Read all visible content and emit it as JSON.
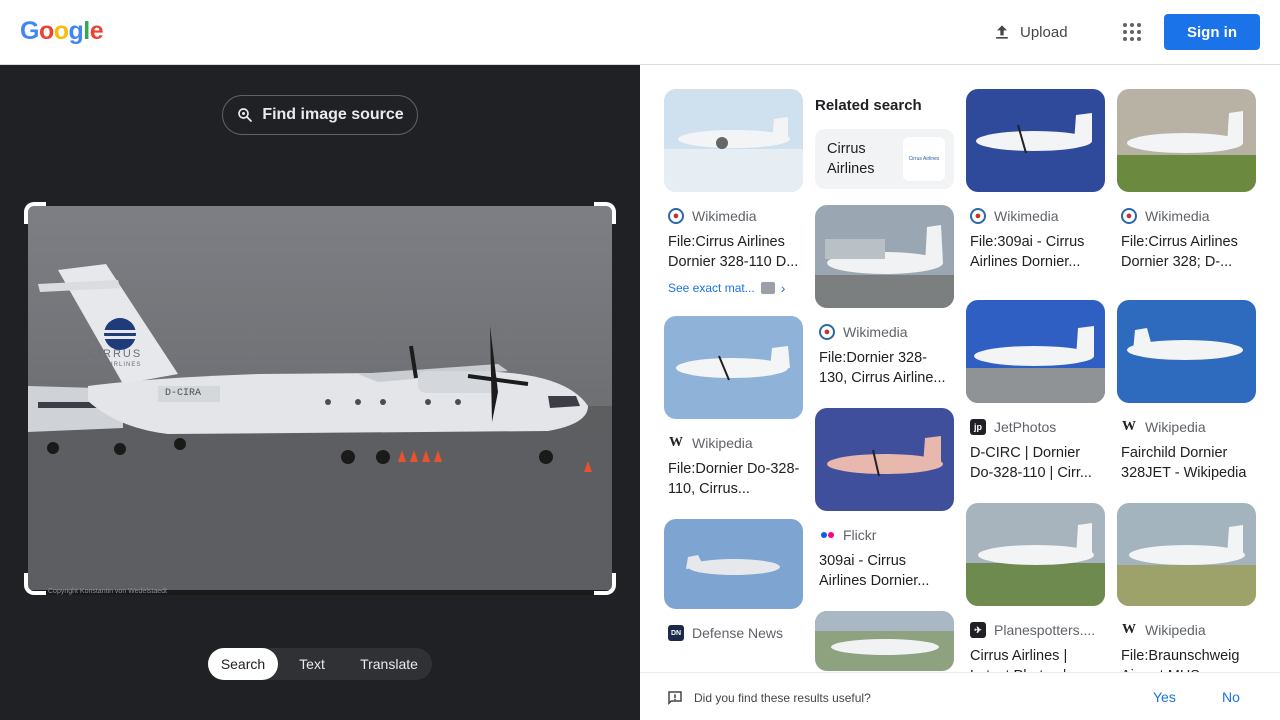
{
  "header": {
    "logo_letters": [
      "G",
      "o",
      "o",
      "g",
      "l",
      "e"
    ],
    "upload_label": "Upload",
    "signin_label": "Sign in"
  },
  "lens": {
    "find_source_label": "Find image source",
    "photo_registration": "D-CIRA",
    "photo_tail_brand": "CIRRUS",
    "photo_tail_sub": "AIRLINES",
    "photo_copyright": "Copyright Konstantin von Wedelstaedt",
    "tabs": [
      "Search",
      "Text",
      "Translate"
    ]
  },
  "results": {
    "col1": [
      {
        "source": "Wikimedia",
        "title": "File:Cirrus Airlines Dornier 328-110 D...",
        "exact": "See exact mat..."
      },
      {
        "source": "Wikipedia",
        "title": "File:Dornier Do-328-110, Cirrus..."
      },
      {
        "source": "Defense News",
        "title": ""
      }
    ],
    "col2": {
      "related_heading": "Related search",
      "related_chip": "Cirrus Airlines",
      "related_mini": "Cirrus Airlines",
      "cards": [
        {
          "source": "Wikimedia",
          "title": "File:Dornier 328-130, Cirrus Airline..."
        },
        {
          "source": "Flickr",
          "title": "309ai - Cirrus Airlines Dornier..."
        }
      ]
    },
    "col3": [
      {
        "source": "Wikimedia",
        "title": "File:309ai - Cirrus Airlines Dornier..."
      },
      {
        "source": "JetPhotos",
        "title": "D-CIRC | Dornier Do-328-110 | Cirr..."
      },
      {
        "source": "Planespotters....",
        "title": "Cirrus Airlines | Latest Photos |..."
      }
    ],
    "col4": [
      {
        "source": "Wikimedia",
        "title": "File:Cirrus Airlines Dornier 328; D-..."
      },
      {
        "source": "Wikipedia",
        "title": "Fairchild Dornier 328JET - Wikipedia"
      },
      {
        "source": "Wikipedia",
        "title": "File:Braunschweig Airport MHS..."
      }
    ]
  },
  "feedback": {
    "question": "Did you find these results useful?",
    "yes": "Yes",
    "no": "No"
  },
  "colors": {
    "accent": "#1a73e8",
    "dark_panel": "#202124"
  }
}
